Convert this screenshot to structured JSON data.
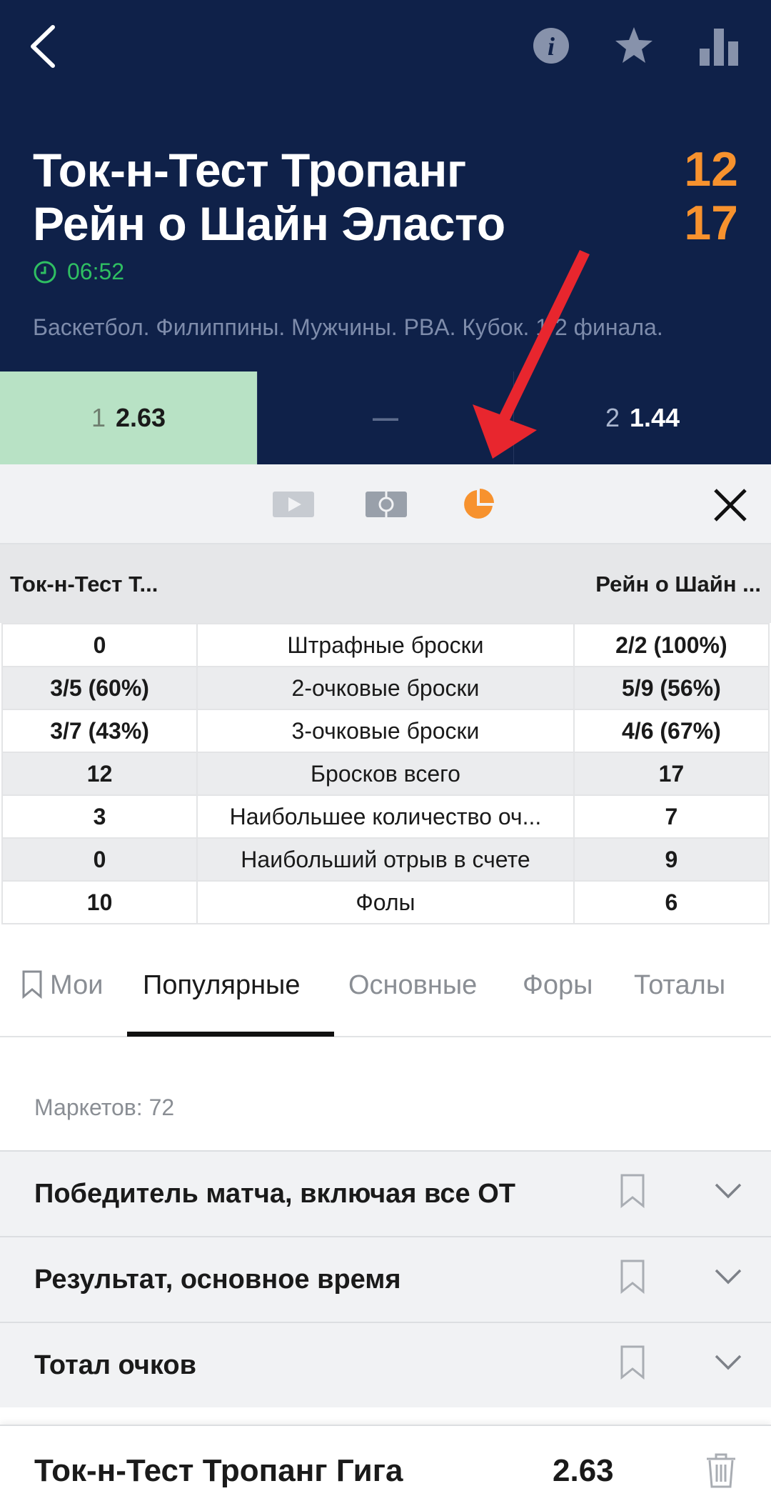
{
  "header": {
    "team1": "Ток-н-Тест Тропанг",
    "team2": "Рейн о Шайн Эласто",
    "score1": "12",
    "score2": "17",
    "timer": "06:52",
    "tournament": "Баскетбол. Филиппины. Мужчины. PBA. Кубок. 1/2 финала.",
    "icons": [
      "back-arrow-icon",
      "info-icon",
      "star-icon",
      "stats-bars-icon"
    ]
  },
  "odds": {
    "home_label": "1",
    "home_value": "2.63",
    "draw_value": "—",
    "away_label": "2",
    "away_value": "1.44"
  },
  "media": {
    "icons": [
      "video-icon",
      "field-icon",
      "pie-chart-icon",
      "close-icon"
    ],
    "active_color": "#f7922e"
  },
  "stats": {
    "team1": "Ток-н-Тест Т...",
    "team2": "Рейн о Шайн ...",
    "rows": [
      {
        "home": "0",
        "label": "Штрафные броски",
        "away": "2/2 (100%)"
      },
      {
        "home": "3/5 (60%)",
        "label": "2-очковые броски",
        "away": "5/9 (56%)"
      },
      {
        "home": "3/7 (43%)",
        "label": "3-очковые броски",
        "away": "4/6 (67%)"
      },
      {
        "home": "12",
        "label": "Бросков всего",
        "away": "17"
      },
      {
        "home": "3",
        "label": "Наибольшее количество оч...",
        "away": "7"
      },
      {
        "home": "0",
        "label": "Наибольший отрыв в счете",
        "away": "9"
      },
      {
        "home": "10",
        "label": "Фолы",
        "away": "6"
      }
    ]
  },
  "tabs": [
    {
      "label": "Мои"
    },
    {
      "label": "Популярные"
    },
    {
      "label": "Основные"
    },
    {
      "label": "Форы"
    },
    {
      "label": "Тоталы"
    }
  ],
  "markets": {
    "count_label": "Маркетов: 72",
    "items": [
      {
        "title": "Победитель матча, включая все ОТ"
      },
      {
        "title": "Результат, основное время"
      },
      {
        "title": "Тотал очков"
      }
    ]
  },
  "betslip": {
    "team": "Ток-н-Тест Тропанг Гига",
    "odd": "2.63"
  },
  "colors": {
    "header_bg": "#0f2149",
    "score": "#f7922e",
    "timer": "#2fbf62",
    "selected_odd_bg": "#b8e2c5",
    "arrow": "#e8262e"
  }
}
